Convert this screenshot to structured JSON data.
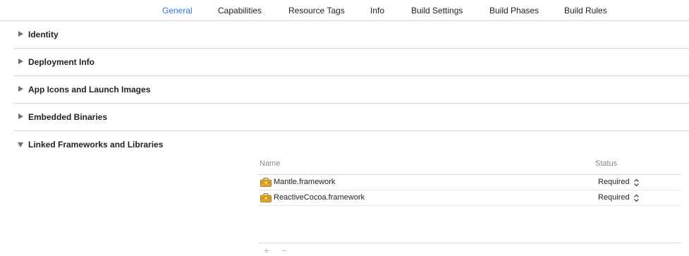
{
  "tabs": [
    {
      "label": "General",
      "active": true
    },
    {
      "label": "Capabilities",
      "active": false
    },
    {
      "label": "Resource Tags",
      "active": false
    },
    {
      "label": "Info",
      "active": false
    },
    {
      "label": "Build Settings",
      "active": false
    },
    {
      "label": "Build Phases",
      "active": false
    },
    {
      "label": "Build Rules",
      "active": false
    }
  ],
  "sections": [
    {
      "title": "Identity",
      "expanded": false,
      "icon": "disclosure-triangle-right-icon"
    },
    {
      "title": "Deployment Info",
      "expanded": false,
      "icon": "disclosure-triangle-right-icon"
    },
    {
      "title": "App Icons and Launch Images",
      "expanded": false,
      "icon": "disclosure-triangle-right-icon"
    },
    {
      "title": "Embedded Binaries",
      "expanded": false,
      "icon": "disclosure-triangle-right-icon"
    },
    {
      "title": "Linked Frameworks and Libraries",
      "expanded": true,
      "icon": "disclosure-triangle-down-icon"
    }
  ],
  "linked_frameworks": {
    "columns": {
      "name": "Name",
      "status": "Status"
    },
    "rows": [
      {
        "name": "Mantle.framework",
        "status": "Required",
        "icon": "framework-toolbox-icon"
      },
      {
        "name": "ReactiveCocoa.framework",
        "status": "Required",
        "icon": "framework-toolbox-icon"
      }
    ],
    "add_label": "+",
    "remove_label": "−"
  },
  "colors": {
    "accent": "#2a7bd8",
    "framework_icon": "#e6a623",
    "muted_text": "#888888"
  }
}
